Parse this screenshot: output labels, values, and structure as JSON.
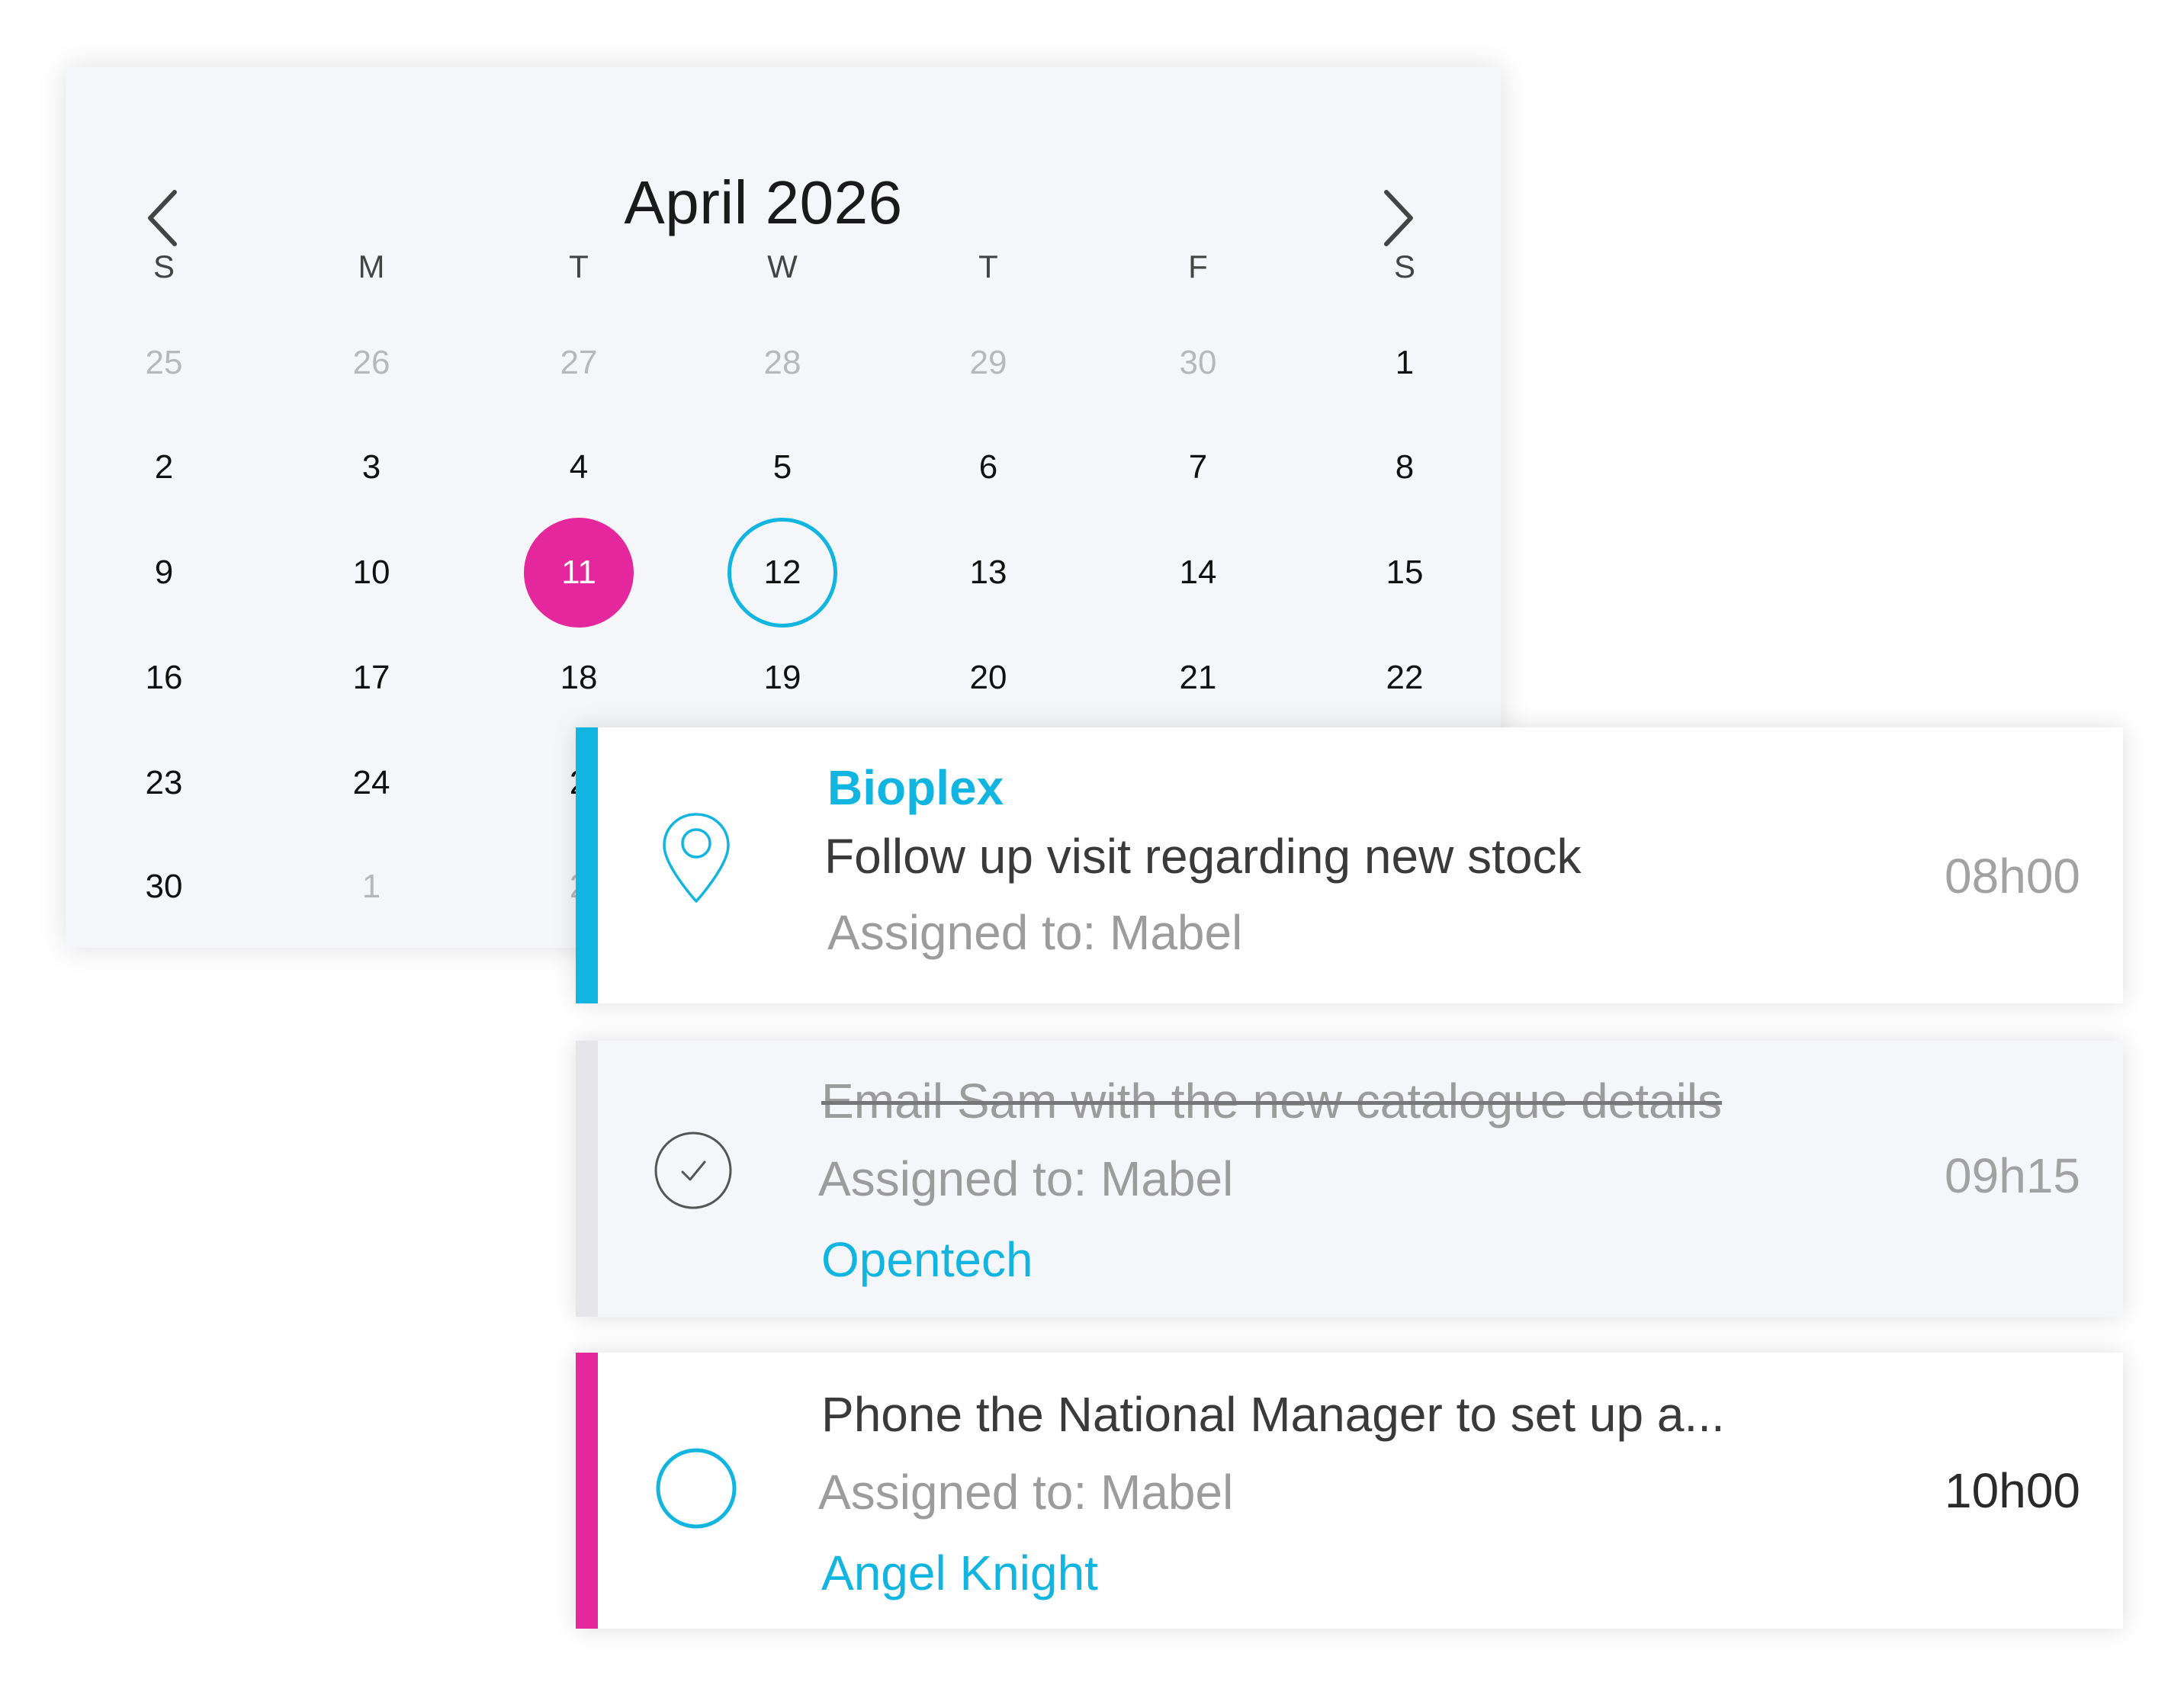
{
  "calendar": {
    "title": "April 2026",
    "prev_label": "chevron-left-icon",
    "next_label": "chevron-right-icon",
    "weekdays": [
      "S",
      "M",
      "T",
      "W",
      "T",
      "F",
      "S"
    ],
    "weeks": [
      [
        {
          "d": "25",
          "muted": true
        },
        {
          "d": "26",
          "muted": true
        },
        {
          "d": "27",
          "muted": true
        },
        {
          "d": "28",
          "muted": true
        },
        {
          "d": "29",
          "muted": true
        },
        {
          "d": "30",
          "muted": true
        },
        {
          "d": "1"
        }
      ],
      [
        {
          "d": "2"
        },
        {
          "d": "3"
        },
        {
          "d": "4"
        },
        {
          "d": "5"
        },
        {
          "d": "6"
        },
        {
          "d": "7"
        },
        {
          "d": "8"
        }
      ],
      [
        {
          "d": "9"
        },
        {
          "d": "10"
        },
        {
          "d": "11",
          "state": "today"
        },
        {
          "d": "12",
          "state": "selected"
        },
        {
          "d": "13"
        },
        {
          "d": "14"
        },
        {
          "d": "15"
        }
      ],
      [
        {
          "d": "16"
        },
        {
          "d": "17"
        },
        {
          "d": "18"
        },
        {
          "d": "19"
        },
        {
          "d": "20"
        },
        {
          "d": "21"
        },
        {
          "d": "22"
        }
      ],
      [
        {
          "d": "23"
        },
        {
          "d": "24"
        },
        {
          "d": "2"
        }
      ],
      [
        {
          "d": "30"
        },
        {
          "d": "1",
          "muted": true
        },
        {
          "d": "2",
          "muted": true
        }
      ]
    ]
  },
  "colors": {
    "accent": "#12b5e0",
    "highlight": "#e4279c",
    "completed": "#e6e6ea"
  },
  "tasks": [
    {
      "company": "Bioplex",
      "title": "Follow up visit regarding new stock",
      "assigned": "Assigned to: Mabel",
      "time": "08h00",
      "icon": "location-pin-icon",
      "status": "scheduled"
    },
    {
      "title": "Email Sam with the new catalogue details",
      "assigned": "Assigned to: Mabel",
      "company": "Opentech",
      "time": "09h15",
      "icon": "check-circle-icon",
      "status": "completed"
    },
    {
      "title": "Phone the National Manager to set up a...",
      "assigned": "Assigned to: Mabel",
      "company": "Angel Knight",
      "time": "10h00",
      "icon": "empty-circle-icon",
      "status": "pending"
    }
  ]
}
